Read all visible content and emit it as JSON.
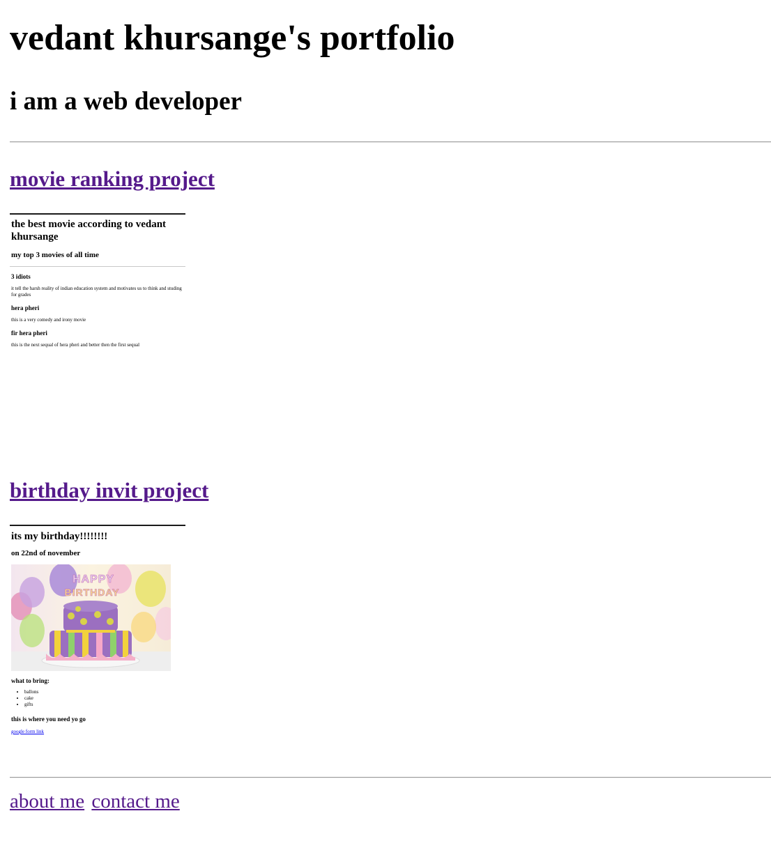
{
  "header": {
    "title": "vedant khursange's portfolio",
    "subtitle": "i am a web developer"
  },
  "projects": {
    "movie": {
      "link_label": "movie ranking project",
      "preview": {
        "title": "the best movie according to vedant khursange",
        "subtitle": "my top 3 movies of all time",
        "movies": [
          {
            "name": "3 idiots",
            "description": "it tell the harsh reality of indian education system and motivates us to think and studing for grades"
          },
          {
            "name": "hera pheri",
            "description": "this is a very comedy and irony movie"
          },
          {
            "name": "fir hera pheri",
            "description": "this is the next sequal of hera pheri and better then the first sequal"
          }
        ]
      }
    },
    "birthday": {
      "link_label": "birthday invit project",
      "preview": {
        "title": "its my birthday!!!!!!!!",
        "date": "on 22nd of november",
        "image_lettering": "HAPPY BIRTHDAY",
        "bring_heading": "what to bring:",
        "bring_items": [
          "ballons",
          "cake",
          "gifts"
        ],
        "location_heading": "this is where you need yo go",
        "form_link": "google form link"
      }
    }
  },
  "footer": {
    "about": "about me",
    "contact": "contact me"
  },
  "colors": {
    "link_visited": "#551a8b",
    "link_unvisited": "#0000ee",
    "text": "#000000",
    "background": "#ffffff"
  }
}
